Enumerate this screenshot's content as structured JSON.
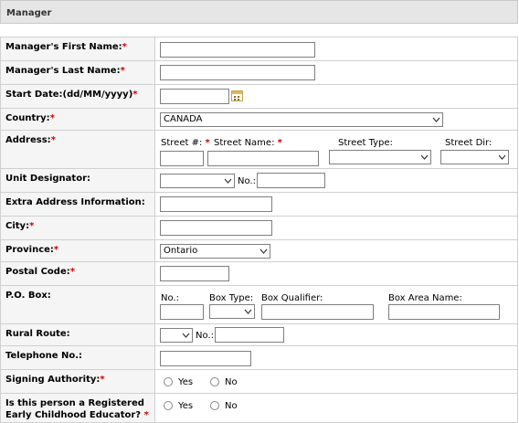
{
  "section_title": "Manager",
  "required_mark": "*",
  "fields": {
    "first_name": {
      "label": "Manager's First Name:",
      "value": ""
    },
    "last_name": {
      "label": "Manager's Last Name:",
      "value": ""
    },
    "start_date": {
      "label": "Start Date:(dd/MM/yyyy)",
      "value": ""
    },
    "country": {
      "label": "Country:",
      "selected": "CANADA"
    },
    "address": {
      "label": "Address:",
      "street_no_label": "Street #:",
      "street_name_label": "Street Name:",
      "street_type_label": "Street Type:",
      "street_dir_label": "Street Dir:"
    },
    "unit": {
      "label": "Unit Designator:",
      "no_label": "No.:"
    },
    "extra": {
      "label": "Extra Address Information:"
    },
    "city": {
      "label": "City:"
    },
    "province": {
      "label": "Province:",
      "selected": "Ontario"
    },
    "postal": {
      "label": "Postal Code:"
    },
    "po_box": {
      "label": "P.O. Box:",
      "no_label": "No.:",
      "type_label": "Box Type:",
      "qualifier_label": "Box Qualifier:",
      "area_label": "Box Area Name:"
    },
    "rural": {
      "label": "Rural Route:",
      "no_label": "No.:"
    },
    "telephone": {
      "label": "Telephone No.:"
    },
    "signing": {
      "label": "Signing Authority:",
      "yes": "Yes",
      "no": "No"
    },
    "ece": {
      "label_line1": "Is this person a Registered",
      "label_line2": "Early Childhood Educator?",
      "yes": "Yes",
      "no": "No"
    }
  }
}
